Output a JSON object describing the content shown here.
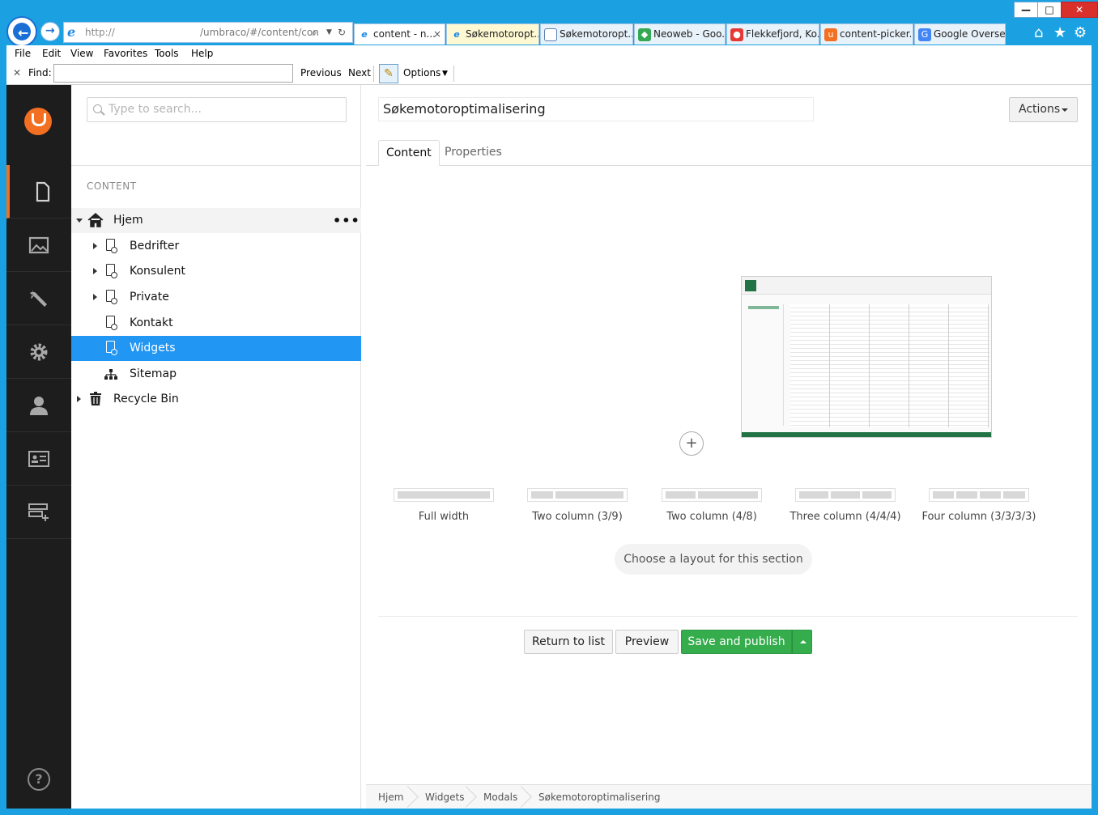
{
  "browser": {
    "address": {
      "protocol": "http://",
      "path": "/umbraco/#/content/con"
    },
    "tabs": [
      {
        "label": "content - n...",
        "active": true
      },
      {
        "label": "Søkemotoropt...",
        "active": false
      },
      {
        "label": "Søkemotoropt...",
        "active": false
      },
      {
        "label": "Neoweb - Goo...",
        "active": false
      },
      {
        "label": "Flekkefjord, Ko...",
        "active": false
      },
      {
        "label": "content-picker...",
        "active": false
      },
      {
        "label": "Google Overse...",
        "active": false
      }
    ],
    "close_tab_glyph": "×",
    "window_controls": [
      "—",
      "□",
      "✕"
    ],
    "menu": [
      "File",
      "Edit",
      "View",
      "Favorites",
      "Tools",
      "Help"
    ],
    "find": {
      "label": "Find:",
      "previous": "Previous",
      "next": "Next",
      "options": "Options",
      "value": ""
    },
    "colors": {
      "chrome": "#1ba1e2",
      "close": "#d9302c"
    }
  },
  "sidebar": {
    "sections": [
      {
        "name": "content",
        "icon": "document-icon",
        "active": true
      },
      {
        "name": "media",
        "icon": "image-icon"
      },
      {
        "name": "developer",
        "icon": "wrench-icon"
      },
      {
        "name": "settings",
        "icon": "gear-icon"
      },
      {
        "name": "users",
        "icon": "user-icon"
      },
      {
        "name": "members",
        "icon": "id-card-icon"
      },
      {
        "name": "forms",
        "icon": "form-icon"
      }
    ],
    "help": "?",
    "accent": "#f36f21"
  },
  "tree": {
    "search_placeholder": "Type to search...",
    "title": "CONTENT",
    "items": [
      {
        "label": "Hjem"
      },
      {
        "label": "Bedrifter"
      },
      {
        "label": "Konsulent"
      },
      {
        "label": "Private"
      },
      {
        "label": "Kontakt"
      },
      {
        "label": "Widgets",
        "selected": true
      },
      {
        "label": "Sitemap"
      },
      {
        "label": "Recycle Bin"
      }
    ],
    "more": "•••",
    "selected_color": "#2196f3"
  },
  "editor": {
    "name": "Søkemotoroptimalisering",
    "actions_label": "Actions",
    "tabs": [
      "Content",
      "Properties"
    ],
    "add_glyph": "+",
    "layouts": [
      {
        "label": "Full width"
      },
      {
        "label": "Two column (3/9)"
      },
      {
        "label": "Two column (4/8)"
      },
      {
        "label": "Three column (4/4/4)"
      },
      {
        "label": "Four column (3/3/3/3)"
      }
    ],
    "choose_layout": "Choose a layout for this section",
    "buttons": {
      "return": "Return to list",
      "preview": "Preview",
      "save_publish": "Save and publish"
    },
    "publish_color": "#35ad4d",
    "breadcrumbs": [
      "Hjem",
      "Widgets",
      "Modals",
      "Søkemotoroptimalisering"
    ]
  }
}
